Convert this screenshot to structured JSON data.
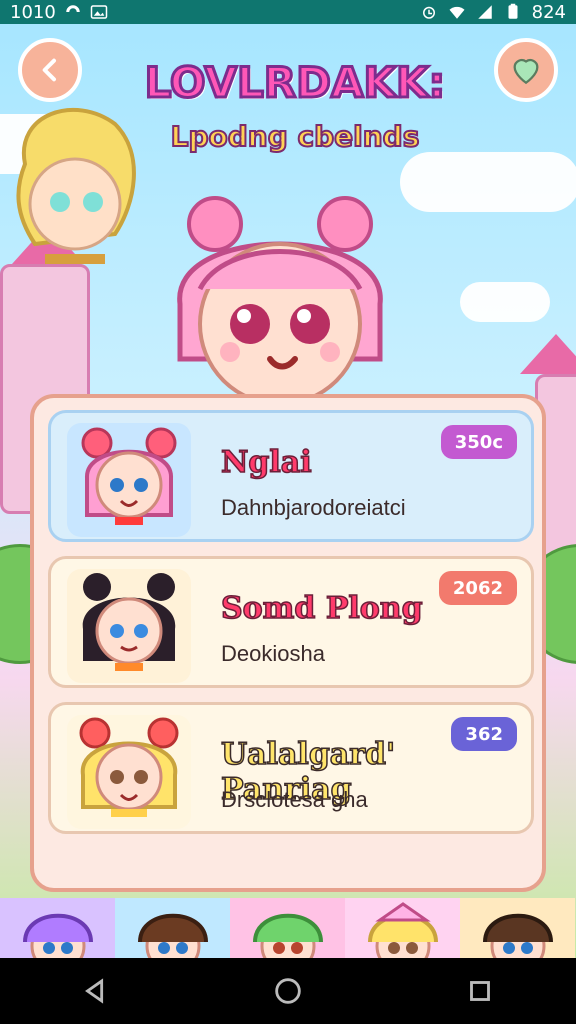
{
  "status_bar": {
    "time": "1010",
    "right_text": "824"
  },
  "header": {
    "title": "LOVLRDAKK:",
    "subtitle": "Lpodng cbelnds",
    "back_button_icon": "chevron-left-icon",
    "favorite_button_icon": "heart-icon"
  },
  "list": {
    "items": [
      {
        "name": "Nglai",
        "subtitle": "Dahnbjarodoreiatci",
        "badge": "350c",
        "badge_color": "#c35ad1",
        "active": true
      },
      {
        "name": "Somd Plong",
        "subtitle": "Deokiosha",
        "badge": "2062",
        "badge_color": "#f27a6d",
        "active": false
      },
      {
        "name": "Ualalgard' Panriag",
        "subtitle": "Drsclotesa gha",
        "badge": "362",
        "badge_color": "#6a63d7",
        "active": false
      }
    ]
  },
  "bottom_strip": {
    "items": [
      {
        "color": "#d9c2ff"
      },
      {
        "color": "#bfe8ff"
      },
      {
        "color": "#ffc2e5"
      },
      {
        "color": "#ffd3f1"
      },
      {
        "color": "#ffe9bf"
      }
    ]
  },
  "nav": {
    "back_icon": "back-triangle-icon",
    "home_icon": "home-circle-icon",
    "recents_icon": "recents-square-icon"
  },
  "colors": {
    "accent": "#ff57b7",
    "status_bar": "#0f766f"
  }
}
